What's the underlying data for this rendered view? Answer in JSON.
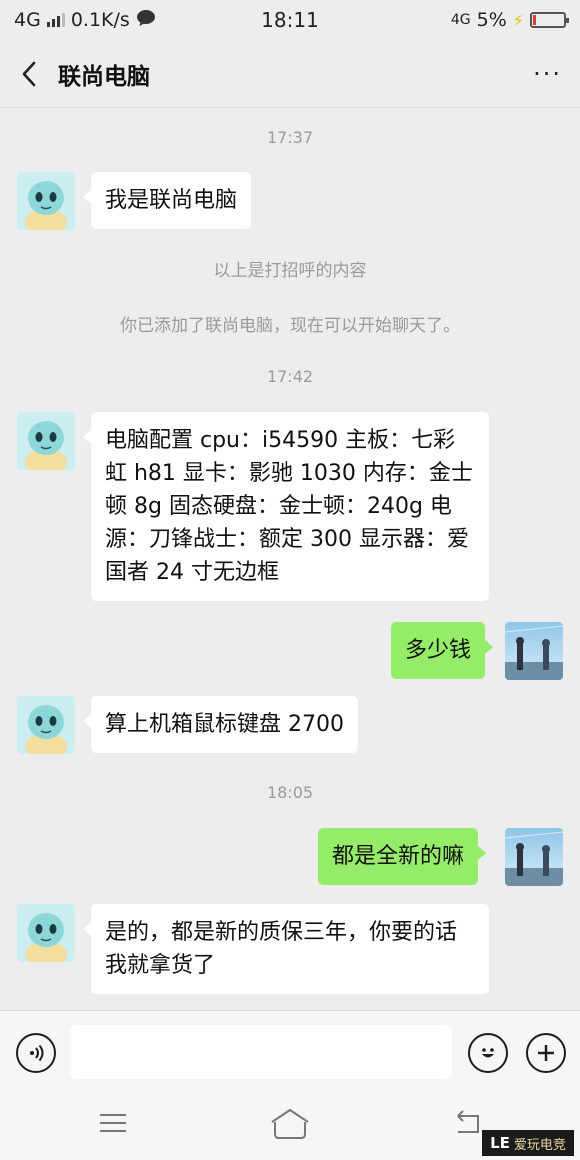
{
  "status_bar": {
    "network_left": "4G",
    "speed": "0.1K/s",
    "time": "18:11",
    "network_right": "4G",
    "battery": "5%",
    "battery_level": 0.05
  },
  "header": {
    "title": "联尚电脑",
    "more": "···"
  },
  "messages": [
    {
      "type": "timestamp",
      "text": "17:37"
    },
    {
      "type": "incoming",
      "text": "我是联尚电脑"
    },
    {
      "type": "system",
      "text": "以上是打招呼的内容"
    },
    {
      "type": "system",
      "text": "你已添加了联尚电脑，现在可以开始聊天了。"
    },
    {
      "type": "timestamp",
      "text": "17:42"
    },
    {
      "type": "incoming",
      "text": "电脑配置 cpu：i54590 主板：七彩虹 h81 显卡：影驰 1030 内存：金士顿 8g 固态硬盘：金士顿：240g 电源：刀锋战士：额定 300 显示器：爱国者 24 寸无边框"
    },
    {
      "type": "outgoing",
      "text": "多少钱"
    },
    {
      "type": "incoming",
      "text": "算上机箱鼠标键盘 2700"
    },
    {
      "type": "timestamp",
      "text": "18:05"
    },
    {
      "type": "outgoing",
      "text": "都是全新的嘛"
    },
    {
      "type": "incoming",
      "text": "是的，都是新的质保三年，你要的话我就拿货了"
    }
  ],
  "input_bar": {
    "voice_icon": "voice-icon",
    "emoji_icon": "emoji-icon",
    "plus_icon": "plus-icon",
    "message_value": ""
  },
  "nav_bar": {
    "menu_icon": "menu-icon",
    "home_icon": "home-icon",
    "back_icon": "back-icon"
  },
  "watermark": {
    "logo": "LE",
    "text": "爱玩电竞"
  },
  "colors": {
    "background": "#ededed",
    "incoming_bubble": "#ffffff",
    "outgoing_bubble": "#95ec69",
    "meta_text": "#9a9a9a"
  }
}
